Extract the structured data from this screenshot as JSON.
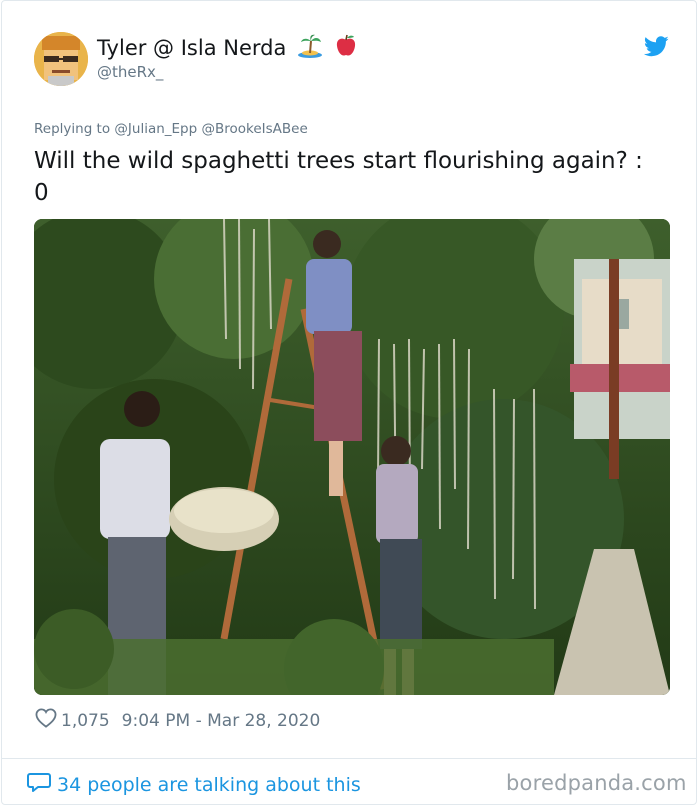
{
  "tweet": {
    "display_name": "Tyler @ Isla Nerda",
    "emoji_icons": [
      "desert-island-icon",
      "apple-icon"
    ],
    "handle": "@theRx_",
    "reply_to": "Replying to @Julian_Epp @BrookeIsABee",
    "text_line1": "Will the wild spaghetti trees start flourishing again? :",
    "text_line2": "0",
    "likes": "1,075",
    "timestamp": "9:04 PM - Mar 28, 2020",
    "talking": "34 people are talking about this"
  },
  "watermark": "boredpanda.com",
  "colors": {
    "accent": "#1b95e0",
    "secondary_text": "#657786",
    "primary_text": "#14171a",
    "border": "#e1e8ed"
  }
}
